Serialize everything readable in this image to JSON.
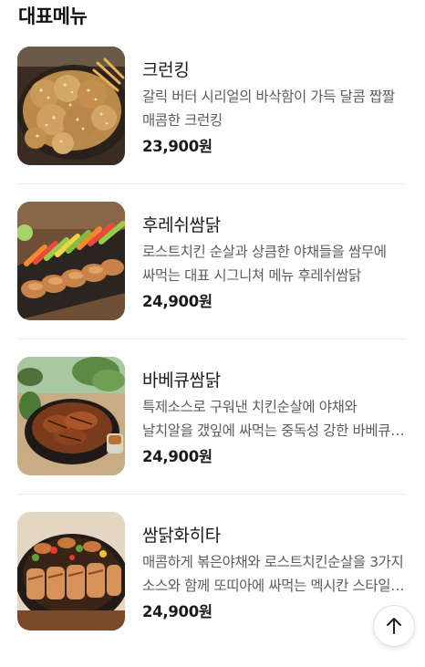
{
  "section": {
    "title": "대표메뉴"
  },
  "menu": [
    {
      "name": "크런킹",
      "description": "갈릭 버터 시리얼의 바삭함이 가득 달콤 짭짤 매콤한 크런킹",
      "price": "23,900원",
      "image": "crunch-king-fried-chicken"
    },
    {
      "name": "후레쉬쌈닭",
      "description": "로스트치킨 순살과 상큼한 야채들을 쌈무에 싸먹는 대표 시그니쳐 메뉴 후레쉬쌈닭",
      "price": "24,900원",
      "image": "fresh-ssamdak-chicken-with-vegetables"
    },
    {
      "name": "바베큐쌈닭",
      "description": "특제소스로 구워낸 치킨순살에 야채와 날치알을 갰잎에 싸먹는 중독성 강한 바베큐 쌈닭",
      "price": "24,900원",
      "image": "bbq-ssamdak-skillet"
    },
    {
      "name": "쌈닭화히타",
      "description": "매콤하게 볶은야채와 로스트치킨순살을 3가지 소스와 함께 또띠아에 싸먹는 멕시칸 스타일 화히타",
      "price": "24,900원",
      "image": "ssamdak-fajita-skillet"
    }
  ],
  "scroll_top": {
    "icon": "arrow-up-icon"
  }
}
